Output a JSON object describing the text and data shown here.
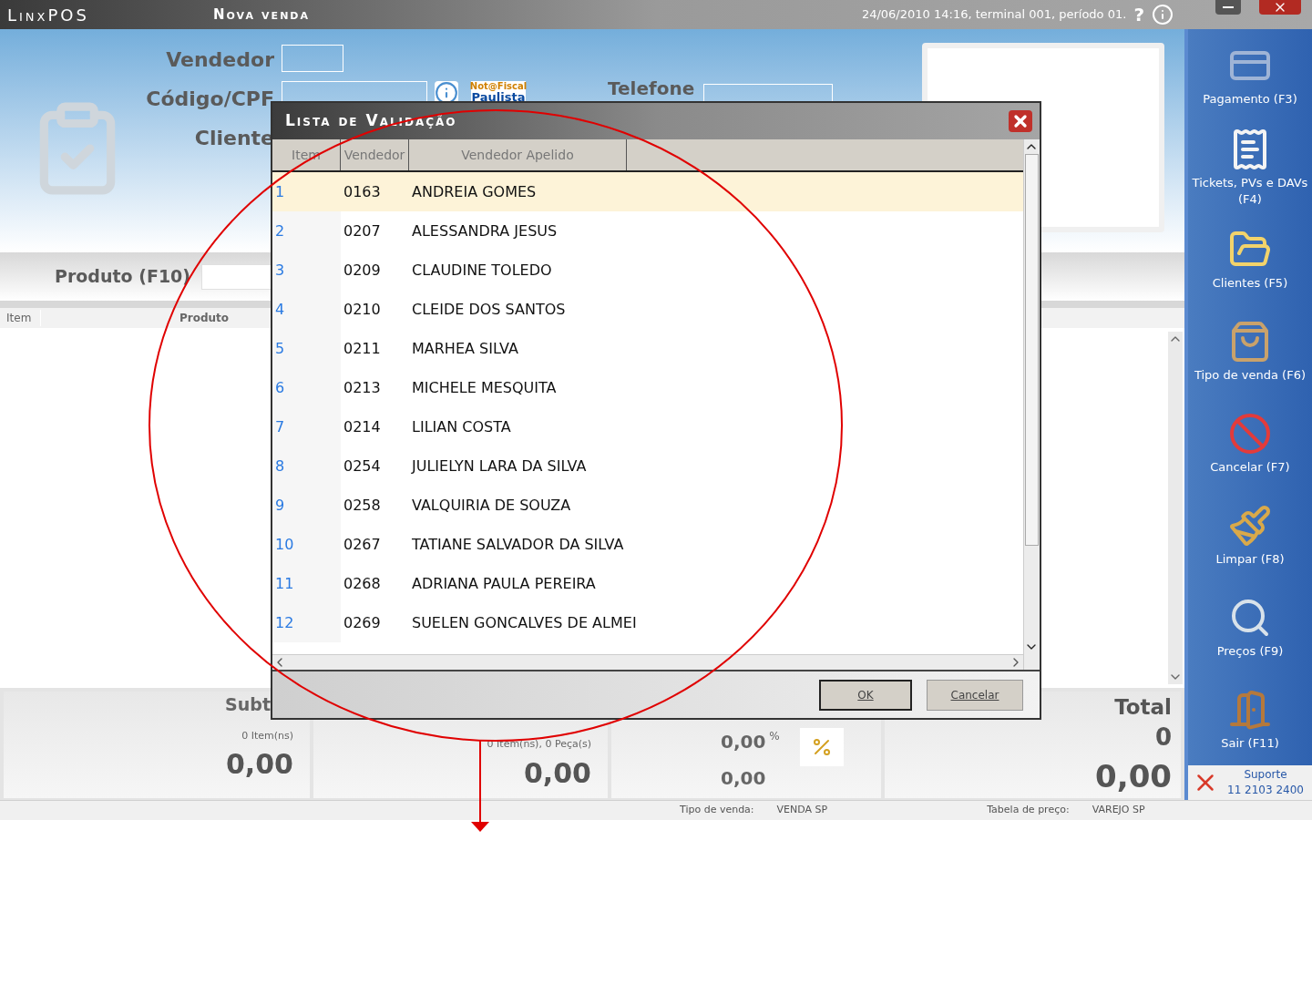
{
  "title_bar": {
    "app_name": "LinxPOS",
    "screen_title": "Nova venda",
    "status": "24/06/2010 14:16, terminal 001, período 01.",
    "help": "?"
  },
  "customer_form": {
    "fields": [
      {
        "label": "Vendedor"
      },
      {
        "label": "Código/CPF"
      },
      {
        "label": "Cliente"
      }
    ],
    "phone_label": "Telefone",
    "logo": [
      "Not@Fiscal",
      "Paulista"
    ]
  },
  "product": {
    "label": "Produto (F10)",
    "columns": [
      "Item",
      "Produto"
    ]
  },
  "totals": {
    "subtotal_label": "Subt",
    "subtotal_count": "0 Item(ns)",
    "subtotal_value": "0,00",
    "items_count": "0 Item(ns), 0 Peça(s)",
    "items_value": "0,00",
    "discount_percent": "0,00",
    "percent_sign": "%",
    "discount_value": "0,00",
    "total_label": "Total",
    "total_count": "0",
    "total_value": "0,00"
  },
  "status_bar": [
    {
      "label": "Tipo de venda:",
      "value": "VENDA SP"
    },
    {
      "label": "Tabela de preço:",
      "value": "VAREJO SP"
    }
  ],
  "sidebar": {
    "items": [
      {
        "label": "Pagamento (F3)",
        "kind": "payment"
      },
      {
        "label": "Tickets, PVs e DAVs (F4)",
        "kind": "tickets"
      },
      {
        "label": "Clientes (F5)",
        "kind": "clients"
      },
      {
        "label": "Tipo de venda (F6)",
        "kind": "sale_type"
      },
      {
        "label": "Cancelar (F7)",
        "kind": "cancel"
      },
      {
        "label": "Limpar (F8)",
        "kind": "clear"
      },
      {
        "label": "Preços (F9)",
        "kind": "prices"
      },
      {
        "label": "Sair (F11)",
        "kind": "exit"
      }
    ],
    "support": {
      "label": "Suporte",
      "phone": "11 2103 2400"
    }
  },
  "dialog": {
    "title": "Lista de Validação",
    "columns": [
      "Item",
      "Vendedor",
      "Vendedor Apelido"
    ],
    "rows": [
      {
        "item": "1",
        "code": "0163",
        "name": "ANDREIA GOMES",
        "selected": true
      },
      {
        "item": "2",
        "code": "0207",
        "name": "ALESSANDRA JESUS",
        "selected": false
      },
      {
        "item": "3",
        "code": "0209",
        "name": "CLAUDINE TOLEDO",
        "selected": false
      },
      {
        "item": "4",
        "code": "0210",
        "name": "CLEIDE DOS SANTOS",
        "selected": false
      },
      {
        "item": "5",
        "code": "0211",
        "name": "MARHEA SILVA",
        "selected": false
      },
      {
        "item": "6",
        "code": "0213",
        "name": "MICHELE MESQUITA",
        "selected": false
      },
      {
        "item": "7",
        "code": "0214",
        "name": "LILIAN COSTA",
        "selected": false
      },
      {
        "item": "8",
        "code": "0254",
        "name": "JULIELYN LARA DA SILVA",
        "selected": false
      },
      {
        "item": "9",
        "code": "0258",
        "name": "VALQUIRIA DE SOUZA",
        "selected": false
      },
      {
        "item": "10",
        "code": "0267",
        "name": "TATIANE SALVADOR DA SILVA",
        "selected": false
      },
      {
        "item": "11",
        "code": "0268",
        "name": "ADRIANA PAULA PEREIRA",
        "selected": false
      },
      {
        "item": "12",
        "code": "0269",
        "name": "SUELEN GONCALVES DE ALMEI",
        "selected": false
      }
    ],
    "buttons": [
      "OK",
      "Cancelar"
    ]
  }
}
